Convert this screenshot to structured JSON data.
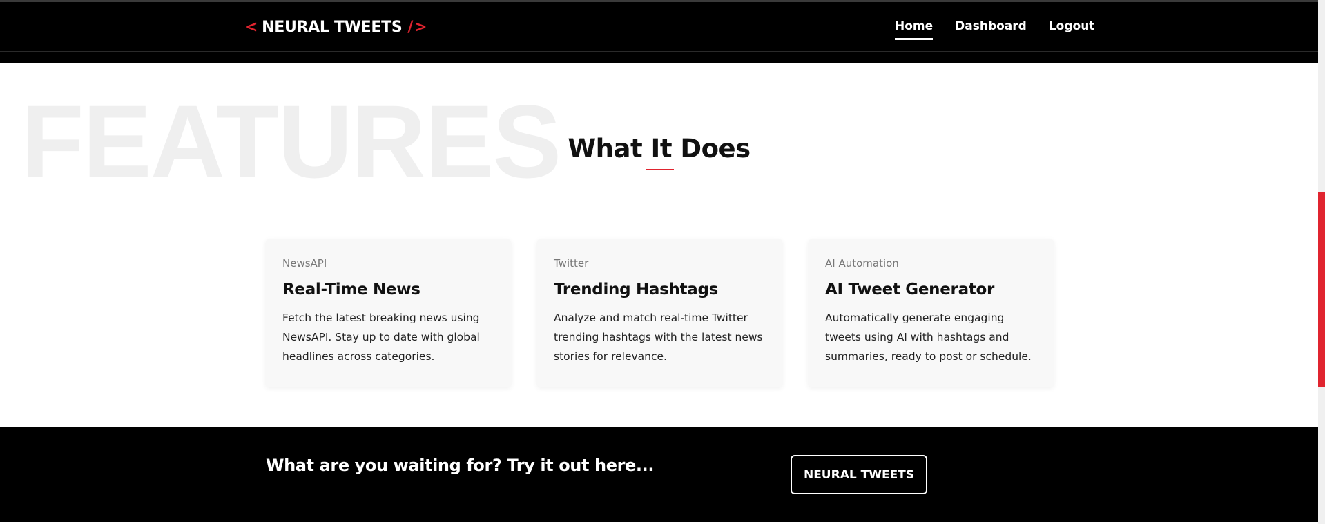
{
  "header": {
    "logo": {
      "left_glyph": "<",
      "text": "NEURAL TWEETS",
      "slash": "/",
      "right_glyph": ">"
    },
    "nav": [
      {
        "label": "Home",
        "active": true
      },
      {
        "label": "Dashboard",
        "active": false
      },
      {
        "label": "Logout",
        "active": false
      }
    ]
  },
  "features": {
    "background_word": "FEATURES",
    "title": "What It Does",
    "cards": [
      {
        "tag": "NewsAPI",
        "title": "Real-Time News",
        "text": "Fetch the latest breaking news using NewsAPI. Stay up to date with global headlines across categories."
      },
      {
        "tag": "Twitter",
        "title": "Trending Hashtags",
        "text": "Analyze and match real-time Twitter trending hashtags with the latest news stories for relevance."
      },
      {
        "tag": "AI Automation",
        "title": "AI Tweet Generator",
        "text": "Automatically generate engaging tweets using AI with hashtags and summaries, ready to post or schedule."
      }
    ]
  },
  "cta": {
    "text": "What are you waiting for? Try it out here...",
    "button_label": "NEURAL TWEETS"
  },
  "colors": {
    "accent": "#e0242f",
    "header_bg": "#000000",
    "card_bg": "#f8f8f8"
  }
}
